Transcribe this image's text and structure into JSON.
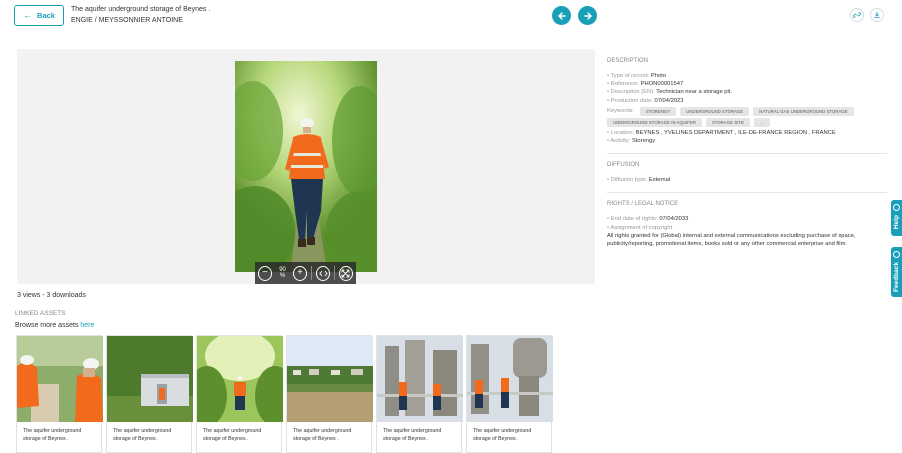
{
  "header": {
    "back_label": "Back",
    "title": "The aquifer underground storage of Beynes .",
    "author": "ENGIE / MEYSSONNIER ANTOINE"
  },
  "icons": {
    "back": "arrow-left-icon",
    "prev": "arrow-left-icon",
    "next": "arrow-right-icon",
    "share": "link-icon",
    "download": "download-icon"
  },
  "viewer": {
    "zoom_level": "90 %"
  },
  "stats": "3 views - 3 downloads",
  "linked": {
    "title": "LINKED ASSETS",
    "browse_text": "Browse more assets ",
    "browse_link": "here",
    "assets": [
      {
        "caption": "The aquifer underground storage of Beynes ."
      },
      {
        "caption": "The aquifer underground storage of Beynes ."
      },
      {
        "caption": "The aquifer underground storage of Beynes ."
      },
      {
        "caption": "The aquifer underground storage of Beynes ."
      },
      {
        "caption": "The aquifer underground storage of Beynes ."
      },
      {
        "caption": "The aquifer underground storage of Beynes ."
      }
    ]
  },
  "description": {
    "title": "DESCRIPTION",
    "type_label": "Type of record:",
    "type_value": "Photo",
    "reference_label": "Reference:",
    "reference_value": "PHON00001547",
    "desc_label": "Description (EN):",
    "desc_value": "Technician near a storage pit.",
    "production_label": "Production date:",
    "production_value": "07/04/2023",
    "keywords_label": "Keywords:",
    "keywords": [
      "STORENGY",
      "UNDERGROUND STORAGE",
      "NATURAL GAS UNDERGROUND STORAGE",
      "UNDERGROUND STORAGE IN AQUIFER",
      "STORAGE SITE",
      "..."
    ],
    "location_label": "Location:",
    "location_value": "BEYNES , YVELINES DEPARTMENT , ILE-DE-FRANCE REGION , FRANCE",
    "activity_label": "Activity:",
    "activity_value": "Storengy"
  },
  "diffusion": {
    "title": "DIFFUSION",
    "type_label": "Diffusion type:",
    "type_value": "External"
  },
  "rights": {
    "title": "RIGHTS / LEGAL NOTICE",
    "end_label": "End date of rights:",
    "end_value": "07/04/2033",
    "assignment_label": "Assignment of copyright",
    "text": "All rights granted for (Global) internal and external communications excluding purchase of space, publicity/reporting, promotional items, books sold or any other commercial enterprise and film."
  },
  "side_tabs": {
    "help": "Help",
    "feedback": "Feedback"
  },
  "colors": {
    "accent": "#1a9fb8",
    "vest": "#f26a1b"
  }
}
